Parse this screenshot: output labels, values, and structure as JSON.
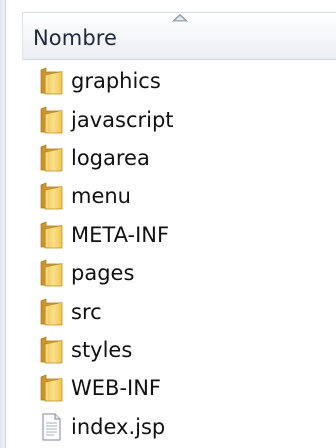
{
  "column_header": {
    "label": "Nombre",
    "sort_indicator": "sort-ascending-arrow-icon"
  },
  "items": [
    {
      "name": "graphics",
      "type": "folder",
      "icon": "folder-icon"
    },
    {
      "name": "javascript",
      "type": "folder",
      "icon": "folder-icon"
    },
    {
      "name": "logarea",
      "type": "folder",
      "icon": "folder-icon"
    },
    {
      "name": "menu",
      "type": "folder",
      "icon": "folder-icon"
    },
    {
      "name": "META-INF",
      "type": "folder",
      "icon": "folder-icon"
    },
    {
      "name": "pages",
      "type": "folder",
      "icon": "folder-icon"
    },
    {
      "name": "src",
      "type": "folder",
      "icon": "folder-icon"
    },
    {
      "name": "styles",
      "type": "folder",
      "icon": "folder-icon"
    },
    {
      "name": "WEB-INF",
      "type": "folder",
      "icon": "folder-icon"
    },
    {
      "name": "index.jsp",
      "type": "file",
      "icon": "file-icon"
    }
  ],
  "colors": {
    "folder_body": "#f3c95a",
    "folder_back": "#d9a532",
    "header_text": "#1c2a3c",
    "item_text": "#111111"
  }
}
